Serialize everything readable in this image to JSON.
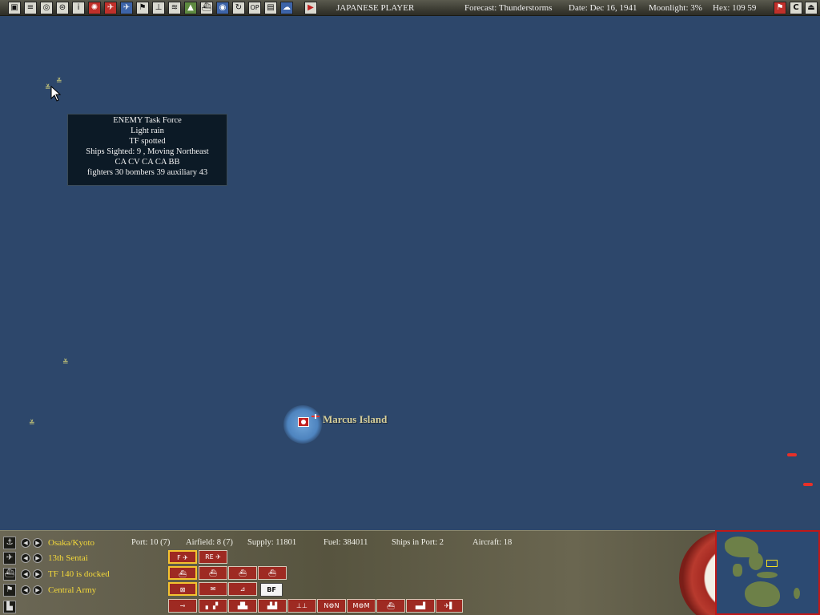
{
  "topbar": {
    "title": "JAPANESE PLAYER",
    "forecast": "Forecast: Thunderstorms",
    "date": "Date: Dec 16, 1941",
    "moonlight": "Moonlight: 3%",
    "hex": "Hex: 109  59",
    "icons_left": [
      "save-icon",
      "document-icon",
      "ship-list-icon",
      "air-list-icon",
      "info-icon",
      "japan-flag-icon",
      "air-group-icon",
      "aircraft-icon",
      "flag-icon",
      "plane-icon",
      "convoy-icon",
      "base-icon",
      "ship-icon",
      "globe-icon",
      "reload-icon",
      "op-icon",
      "table-icon",
      "cloud-icon",
      "play-icon"
    ],
    "op_label": "OP",
    "info_label": "i",
    "c_label": "C"
  },
  "map": {
    "tooltip": {
      "line1": "ENEMY Task Force",
      "line2": "Light rain",
      "line3": "TF spotted",
      "line4": "Ships Sighted: 9 , Moving Northeast",
      "line5": "CA CV CA CA BB",
      "line6": "fighters 30   bombers 39   auxiliary 43"
    },
    "base_label": "Marcus Island"
  },
  "bottom": {
    "row1": {
      "label": "Osaka/Kyoto",
      "port": "Port: 10 (7)",
      "airfield": "Airfield: 8 (7)",
      "supply": "Supply: 11801",
      "fuel": "Fuel: 384011",
      "ships": "Ships in Port: 2",
      "aircraft": "Aircraft: 18"
    },
    "row2": {
      "label": "13th Sentai",
      "btn_f": "F",
      "btn_re": "RE"
    },
    "row3": {
      "label": "TF 140 is docked"
    },
    "row4": {
      "label": "Central Army",
      "btn_bf": "BF"
    },
    "row5": {
      "btn_n1": "N",
      "btn_n2": "N",
      "btn_m1": "M",
      "btn_m2": "M"
    }
  },
  "colors": {
    "sea": "#2d476b",
    "tooltip_bg": "#0c1a26",
    "label_yellow": "#f4d93a",
    "button_red": "#9e2a22",
    "enemy_red": "#e83028",
    "friendly_yellow": "#e6e07a"
  }
}
